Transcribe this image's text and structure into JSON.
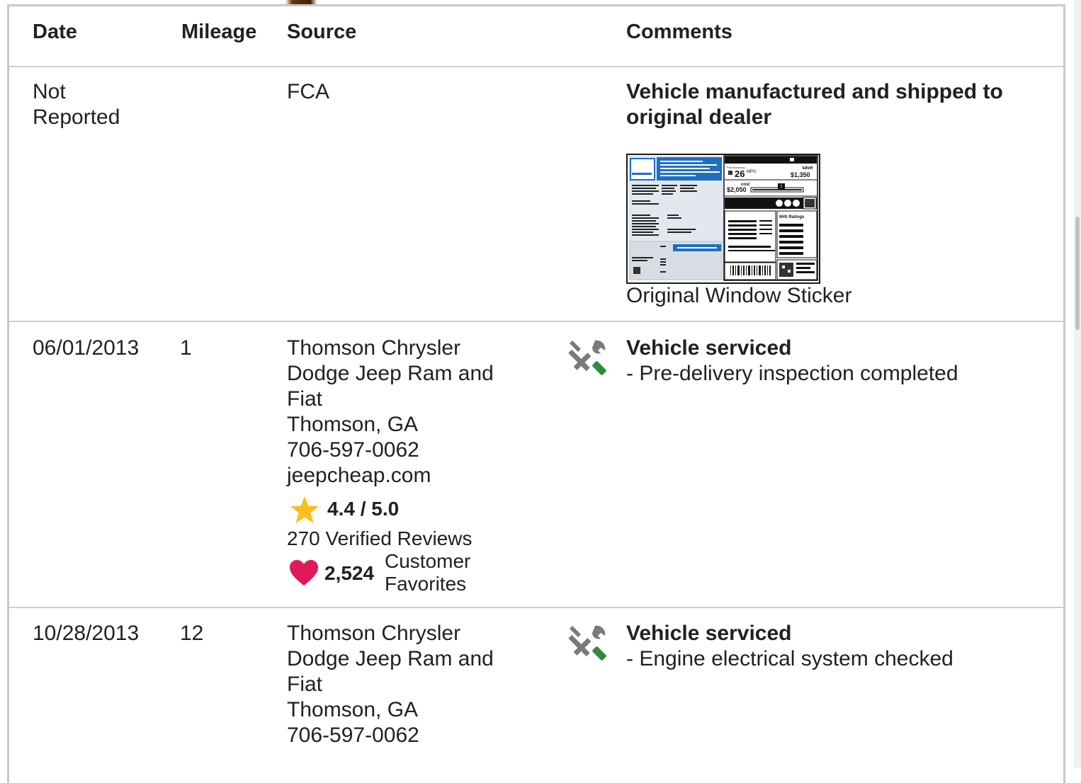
{
  "table": {
    "headers": {
      "date": "Date",
      "mileage": "Mileage",
      "source": "Source",
      "comments": "Comments"
    },
    "rows": [
      {
        "date_line1": "Not",
        "date_line2": "Reported",
        "mileage": "",
        "source_name": "FCA",
        "comment_title": "Vehicle manufactured and shipped to",
        "comment_title_line2": "original dealer",
        "sticker_label": "Original Window Sticker",
        "sticker": {
          "fuel_economy": "26",
          "mpg": "MPG",
          "you_save": "save",
          "save_amount": "$1,350",
          "annual_fuel": "cost",
          "annual_cost": "$2,050",
          "scale": "7",
          "ratings": "IIHS Ratings"
        }
      },
      {
        "date": "06/01/2013",
        "mileage": "1",
        "source_line1": "Thomson Chrysler",
        "source_line2": "Dodge Jeep Ram and",
        "source_line3": "Fiat",
        "source_line4": "Thomson, GA",
        "source_line5": "706-597-0062",
        "source_line6": "jeepcheap.com",
        "rating": "4.4 / 5.0",
        "reviews": "270 Verified Reviews",
        "favorites_count": "2,524",
        "favorites_label1": "Customer",
        "favorites_label2": "Favorites",
        "comment_title": "Vehicle serviced",
        "comment_detail": "- Pre-delivery inspection completed"
      },
      {
        "date": "10/28/2013",
        "mileage": "12",
        "source_line1": "Thomson Chrysler",
        "source_line2": "Dodge Jeep Ram and",
        "source_line3": "Fiat",
        "source_line4": "Thomson, GA",
        "source_line5": "706-597-0062",
        "comment_title": "Vehicle serviced",
        "comment_detail": "- Engine electrical system checked"
      }
    ]
  },
  "colors": {
    "star": "#fbbd1f",
    "heart": "#e0195a",
    "wrench_gray": "#7a7a7a",
    "screwdriver_green": "#2e8b3d",
    "sticker_blue": "#1f6fbf"
  },
  "icons": [
    "service-icon",
    "star-icon",
    "heart-icon"
  ]
}
